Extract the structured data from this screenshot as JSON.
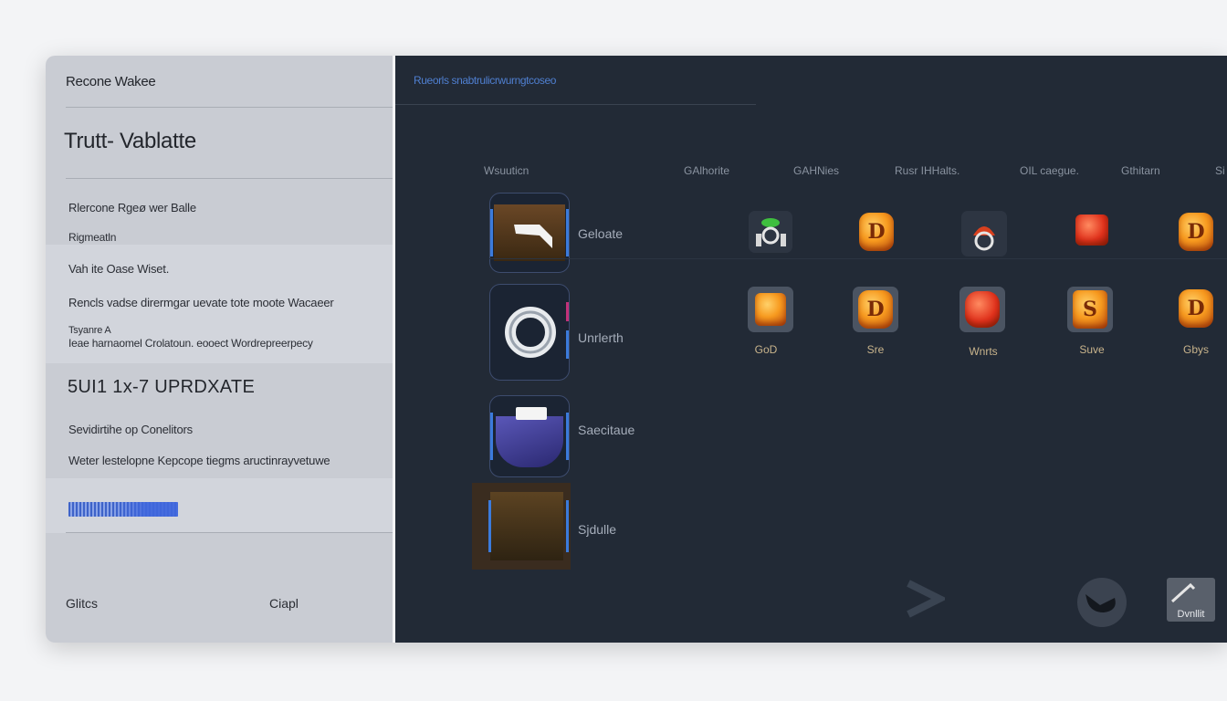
{
  "sidebar": {
    "brand": "Recone Wakee",
    "title": "Trutt- Vablatte",
    "lines": [
      "Rlercone Rgeø wer Balle",
      "Rigmeatln",
      "Vah ite Oase Wiset.",
      "Rencls vadse dirermgar uevate tote moote Wacaeer",
      "Tsyanre A",
      "Ieae harnaomel Crolatoun. eooect Wordrepreerpecy"
    ],
    "section_title": "5UI1 1x-7 UPRDXATE",
    "details": [
      "Sevidirtihe op Conelitors",
      "Weter lestelopne Kepcope tiegms aructinrayvetuwe"
    ],
    "progress": 1.0,
    "footer": {
      "left": "Glitcs",
      "right": "Ciapl"
    }
  },
  "main": {
    "breadcrumb": "Rueorls snabtrulicrwurngtcoseo",
    "columns": [
      "Wsuuticn",
      "GAlhorite",
      "GAHNies",
      "Rusr IHHalts.",
      "OIL caegue.",
      "Gthitarn",
      "Si"
    ],
    "rows": [
      {
        "label": "Geloate"
      },
      {
        "label": "Unrlerth"
      },
      {
        "label": "Saecitaue"
      },
      {
        "label": "Sjdulle"
      }
    ],
    "row1_icon_glyphs": [
      "",
      "D",
      "",
      "",
      "D"
    ],
    "row2_icon_glyphs": [
      "",
      "D",
      "",
      "S",
      "D"
    ],
    "row2_captions": [
      "GoD",
      "Sre",
      "Wnrts",
      "Suve",
      "Gbys"
    ],
    "controls": {
      "box_label": "Dvnllit"
    }
  },
  "colors": {
    "sidebar_bg": "#c9ccd3",
    "main_bg": "#222a36",
    "accent": "#3b7bdc",
    "breadcrumb": "#4f7fd0"
  },
  "icons": {
    "row1": [
      "alien-icon",
      "coin-gem-icon",
      "helmet-icon",
      "red-gem-icon",
      "coin-gem-icon"
    ],
    "row2": [
      "orange-block-icon",
      "coin-gem-icon",
      "red-beast-icon",
      "fire-gem-icon",
      "coin-gem-icon"
    ]
  }
}
